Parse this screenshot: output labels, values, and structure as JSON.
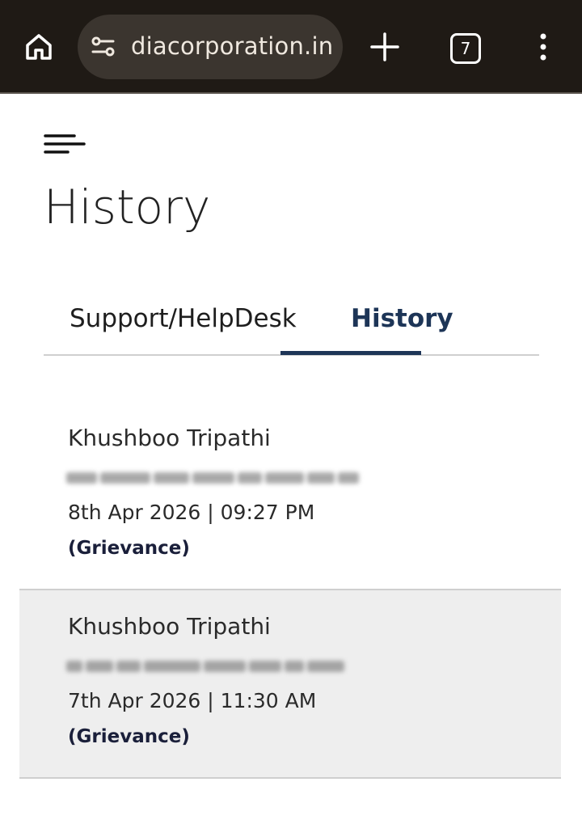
{
  "browser": {
    "url": "diacorporation.in",
    "tab_count": "7",
    "icons": [
      "home-icon",
      "site-settings-icon",
      "new-tab-icon",
      "tab-switcher-icon",
      "more-menu-icon"
    ]
  },
  "page": {
    "title": "History",
    "menu_icon": "hamburger-menu-icon"
  },
  "tabs": [
    {
      "label": "Support/HelpDesk",
      "active": false
    },
    {
      "label": "History",
      "active": true
    }
  ],
  "history": [
    {
      "name": "Khushboo Tripathi",
      "date": "8th Apr 2026 | 09:27 PM",
      "type": "(Grievance)"
    },
    {
      "name": "Khushboo Tripathi",
      "date": "7th Apr 2026 | 11:30 AM",
      "type": "(Grievance)"
    }
  ],
  "colors": {
    "accent": "#1d3557",
    "chrome_bg": "#1f1a15",
    "selected_row_bg": "#eeeeee"
  }
}
